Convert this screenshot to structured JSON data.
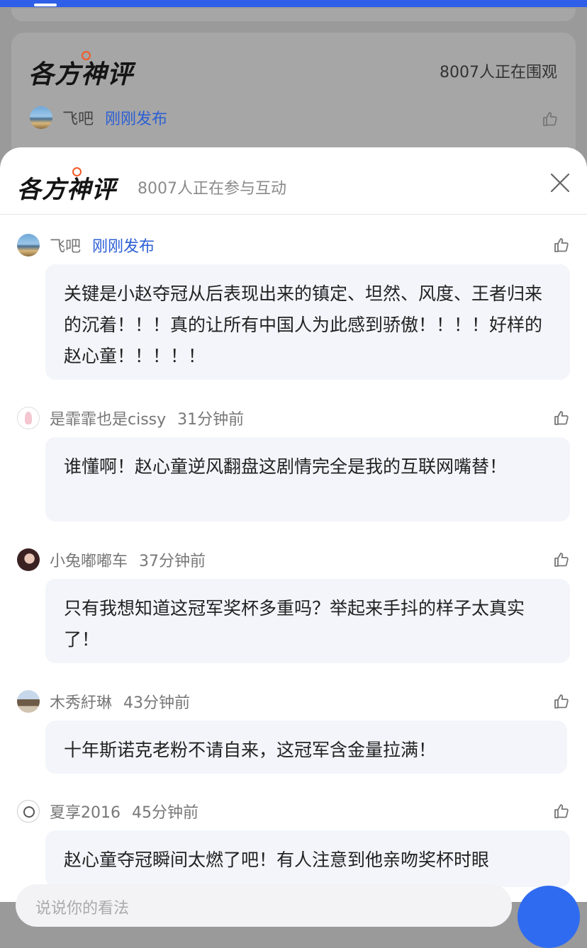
{
  "background_card": {
    "title": "各方神评",
    "viewer_count": "8007人正在围观",
    "user": "飞吧",
    "time": "刚刚发布"
  },
  "sheet": {
    "title": "各方神评",
    "participant_count": "8007人正在参与互动"
  },
  "comments": [
    {
      "user": "飞吧",
      "time": "刚刚发布",
      "text": "关键是小赵夺冠从后表现出来的镇定、坦然、风度、王者归来的沉着！！！真的让所有中国人为此感到骄傲！！！！好样的赵心童！！！！！"
    },
    {
      "user": "是霏霏也是cissy",
      "time": "31分钟前",
      "text": "谁懂啊！赵心童逆风翻盘这剧情完全是我的互联网嘴替！"
    },
    {
      "user": "小兔嘟嘟车",
      "time": "37分钟前",
      "text": "只有我想知道这冠军奖杯多重吗？举起来手抖的样子太真实了！"
    },
    {
      "user": "木秀紆琳",
      "time": "43分钟前",
      "text": "十年斯诺克老粉不请自来，这冠军含金量拉满！"
    },
    {
      "user": "夏享2016",
      "time": "45分钟前",
      "text": "赵心童夺冠瞬间太燃了吧！有人注意到他亲吻奖杯时眼"
    }
  ],
  "composer": {
    "placeholder": "说说你的看法"
  },
  "icons": {
    "like": "thumbs-up-icon",
    "close": "close-icon"
  },
  "colors": {
    "accent_blue": "#2f5fe8",
    "link_blue": "#2c5fd4",
    "brand_dot": "#f05a28",
    "bubble_bg": "#f3f5fa"
  }
}
